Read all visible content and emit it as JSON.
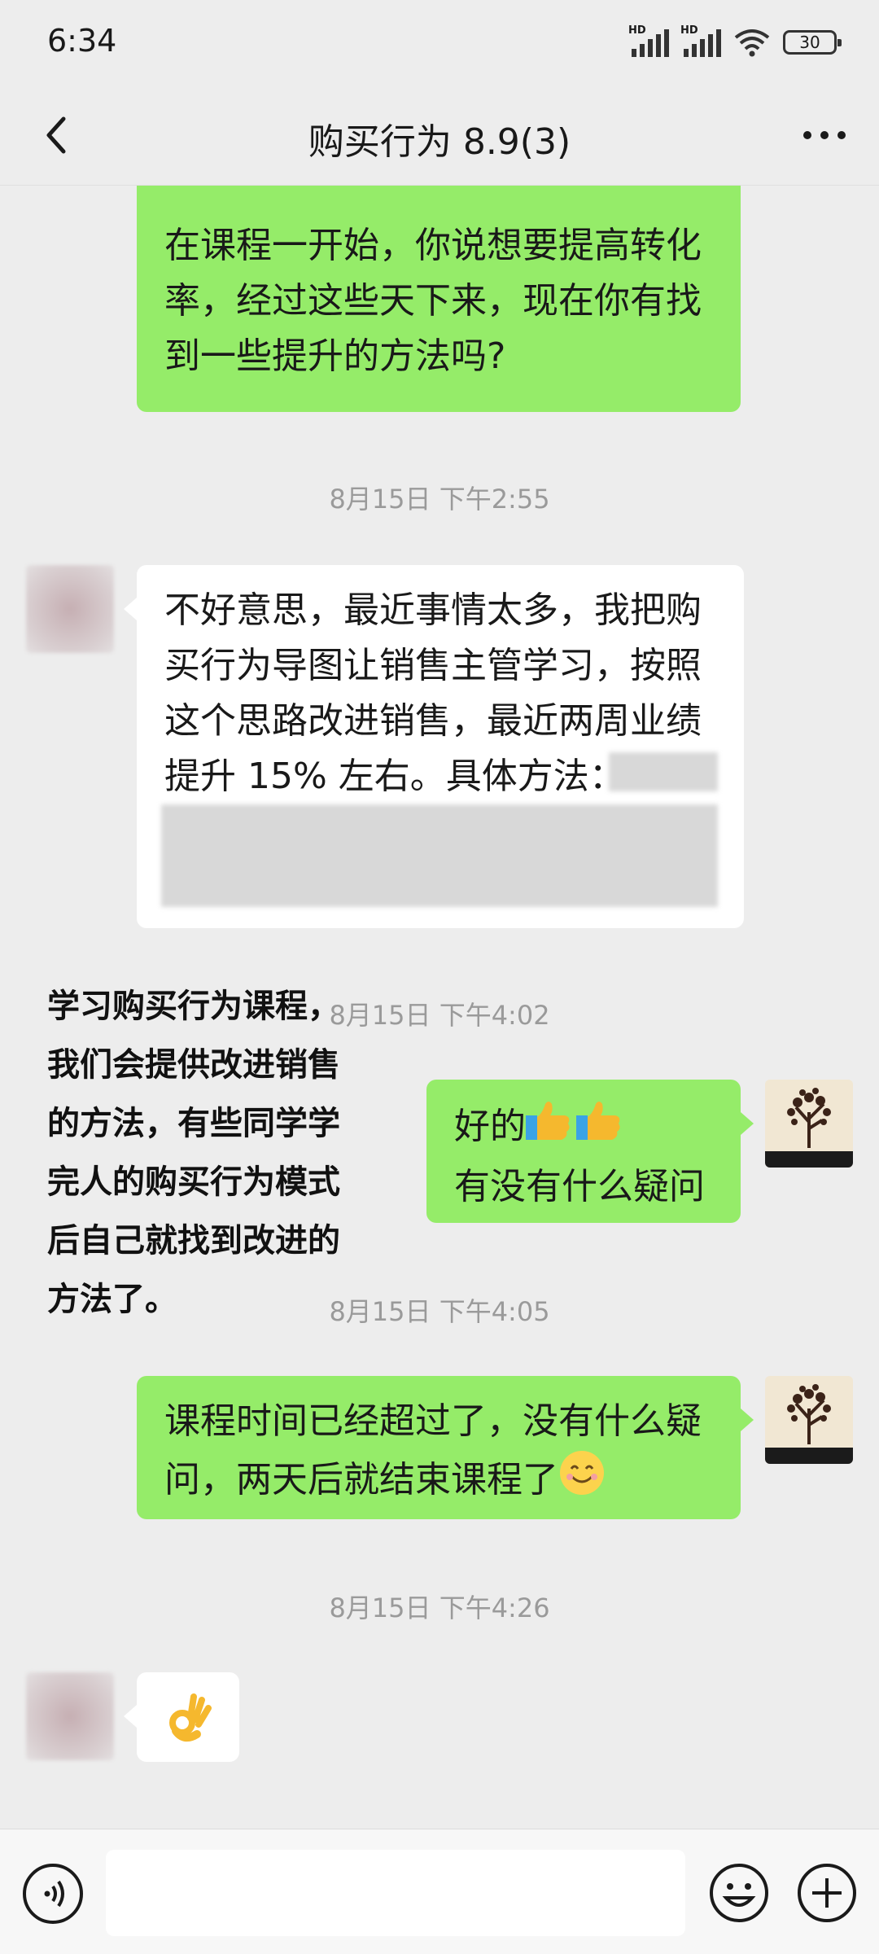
{
  "status": {
    "time": "6:34",
    "battery": "30",
    "hd_label": "HD"
  },
  "nav": {
    "title": "购买行为 8.9(3)"
  },
  "messages": {
    "m1": {
      "lines": [
        "在课程一开始，你说想要提高转化",
        "率，经过这些天下来，现在你有找",
        "到一些提升的方法吗?"
      ]
    },
    "t1": "8月15日 下午2:55",
    "m2": {
      "lines": [
        "不好意思，最近事情太多，我把购",
        "买行为导图让销售主管学习，按照",
        "这个思路改进销售，最近两周业绩",
        "提升 15% 左右。具体方法："
      ]
    },
    "t2": "8月15日 下午4:02",
    "m3": {
      "line1": "好的",
      "line2": "有没有什么疑问"
    },
    "t3": "8月15日 下午4:05",
    "m4": {
      "lines": [
        "课程时间已经超过了，没有什么疑",
        "问，两天后就结束课程了"
      ]
    },
    "t4": "8月15日 下午4:26"
  },
  "overlay_text": [
    "学习购买行为课程，",
    "我们会提供改进销售",
    "的方法，有些同学学",
    "完人的购买行为模式",
    "后自己就找到改进的",
    "方法了。"
  ],
  "icons": {
    "back": "chevron-left-icon",
    "more": "more-dots-icon",
    "voice": "voice-icon",
    "emoji": "emoji-icon",
    "plus": "plus-icon",
    "thumbs": "thumbs-up-emoji",
    "smile": "smile-emoji",
    "ok": "ok-hand-emoji"
  },
  "colors": {
    "green_bubble": "#95ec69",
    "background": "#ededed"
  }
}
